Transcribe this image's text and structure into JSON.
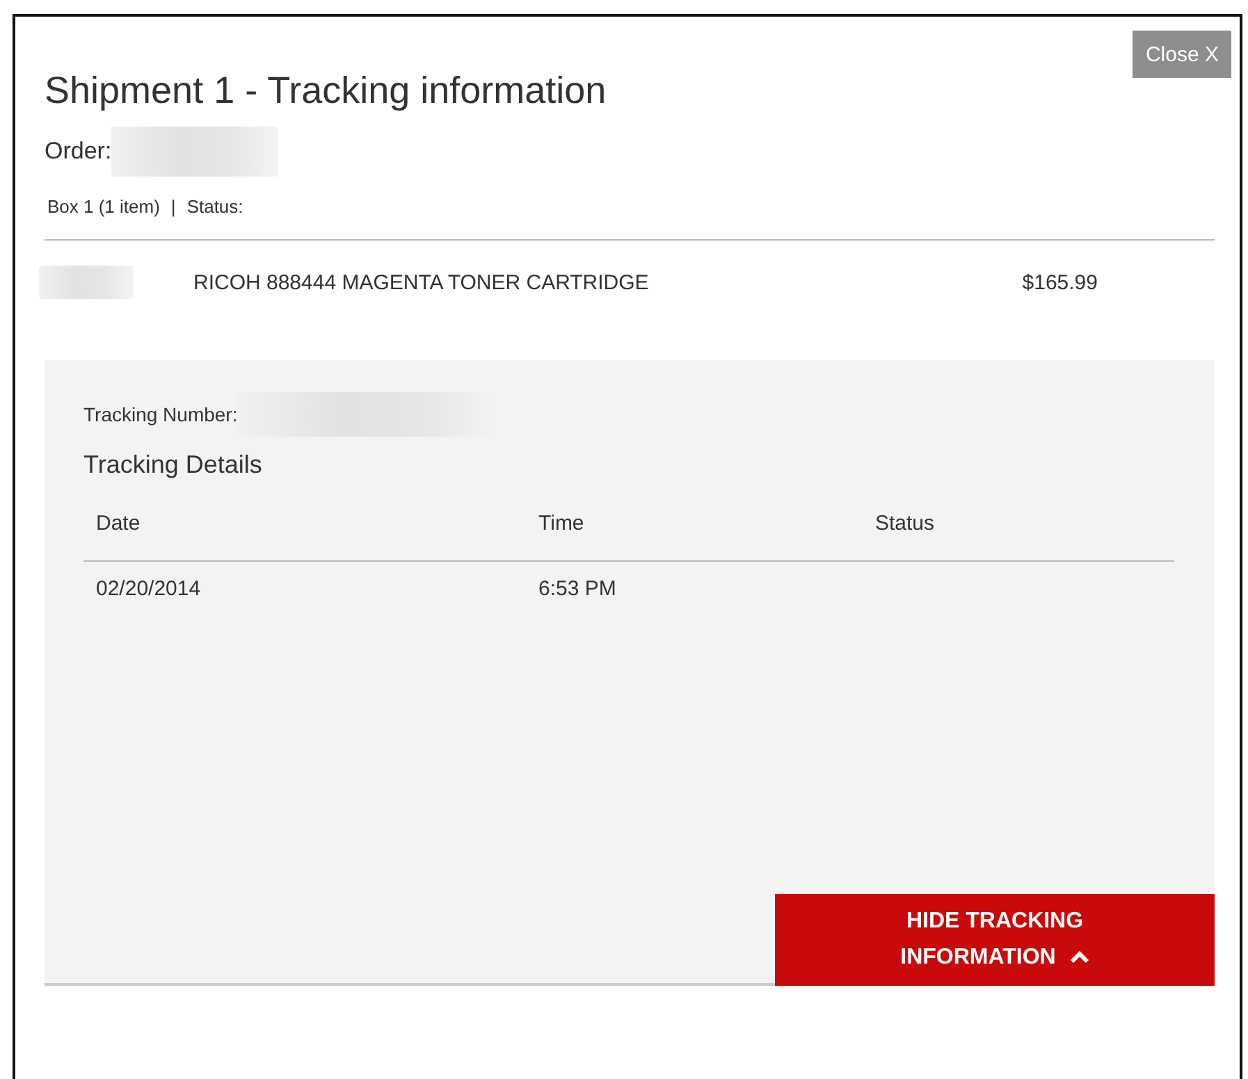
{
  "close_button": "Close X",
  "title": "Shipment 1 - Tracking information",
  "order_label": "Order:",
  "box_line": {
    "box": "Box  1 (1 item)",
    "separator": "|",
    "status_label": "Status:"
  },
  "item": {
    "name": "RICOH 888444 MAGENTA TONER CARTRIDGE",
    "price": "$165.99"
  },
  "tracking": {
    "number_label": "Tracking Number:",
    "details_heading": "Tracking Details",
    "columns": [
      "Date",
      "Time",
      "Status"
    ],
    "rows": [
      [
        "02/20/2014",
        "6:53 PM",
        ""
      ]
    ]
  },
  "hide_button": "HIDE TRACKING INFORMATION"
}
